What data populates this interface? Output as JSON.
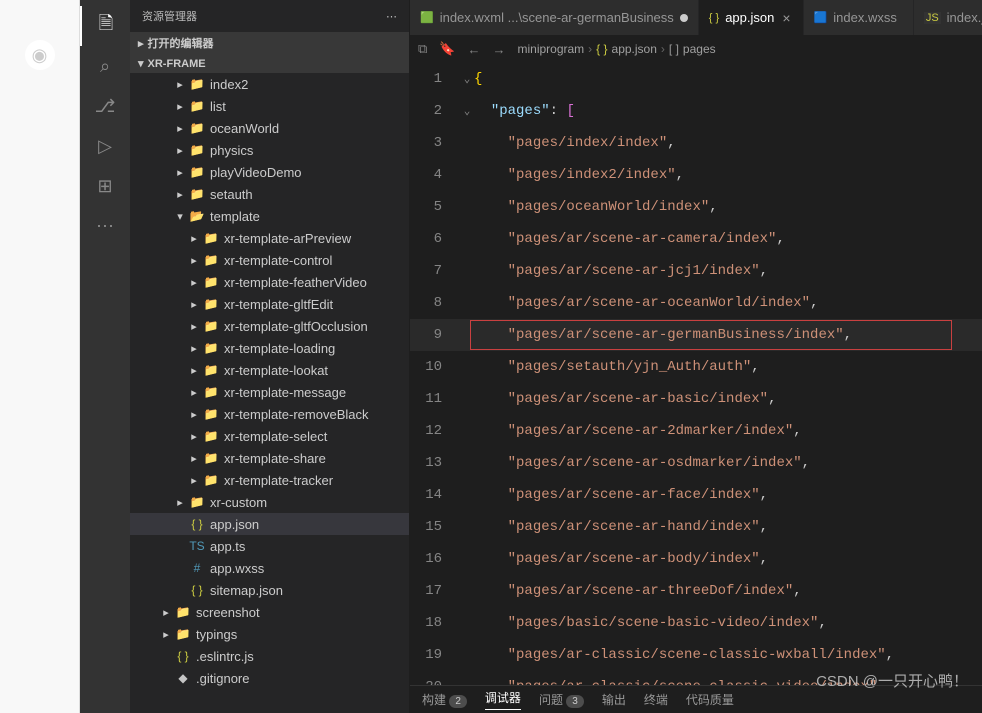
{
  "activity": {
    "icons": [
      "files",
      "search",
      "branch",
      "debug",
      "ext",
      "more"
    ]
  },
  "sidebar": {
    "title": "资源管理器",
    "sections": {
      "openEditors": "打开的编辑器",
      "project": "XR-FRAME"
    },
    "tree": [
      {
        "depth": 3,
        "type": "folder",
        "label": "index2",
        "chev": "▸"
      },
      {
        "depth": 3,
        "type": "folder",
        "label": "list",
        "chev": "▸"
      },
      {
        "depth": 3,
        "type": "folder",
        "label": "oceanWorld",
        "chev": "▸"
      },
      {
        "depth": 3,
        "type": "folder",
        "label": "physics",
        "chev": "▸"
      },
      {
        "depth": 3,
        "type": "folder",
        "label": "playVideoDemo",
        "chev": "▸"
      },
      {
        "depth": 3,
        "type": "folder",
        "label": "setauth",
        "chev": "▸"
      },
      {
        "depth": 3,
        "type": "folder-open",
        "label": "template",
        "chev": "▾"
      },
      {
        "depth": 4,
        "type": "folder",
        "label": "xr-template-arPreview",
        "chev": "▸"
      },
      {
        "depth": 4,
        "type": "folder",
        "label": "xr-template-control",
        "chev": "▸"
      },
      {
        "depth": 4,
        "type": "folder",
        "label": "xr-template-featherVideo",
        "chev": "▸"
      },
      {
        "depth": 4,
        "type": "folder",
        "label": "xr-template-gltfEdit",
        "chev": "▸"
      },
      {
        "depth": 4,
        "type": "folder",
        "label": "xr-template-gltfOcclusion",
        "chev": "▸"
      },
      {
        "depth": 4,
        "type": "folder",
        "label": "xr-template-loading",
        "chev": "▸"
      },
      {
        "depth": 4,
        "type": "folder",
        "label": "xr-template-lookat",
        "chev": "▸"
      },
      {
        "depth": 4,
        "type": "folder",
        "label": "xr-template-message",
        "chev": "▸"
      },
      {
        "depth": 4,
        "type": "folder",
        "label": "xr-template-removeBlack",
        "chev": "▸"
      },
      {
        "depth": 4,
        "type": "folder",
        "label": "xr-template-select",
        "chev": "▸"
      },
      {
        "depth": 4,
        "type": "folder",
        "label": "xr-template-share",
        "chev": "▸"
      },
      {
        "depth": 4,
        "type": "folder",
        "label": "xr-template-tracker",
        "chev": "▸"
      },
      {
        "depth": 3,
        "type": "folder",
        "label": "xr-custom",
        "chev": "▸"
      },
      {
        "depth": 3,
        "type": "json",
        "label": "app.json",
        "selected": true
      },
      {
        "depth": 3,
        "type": "ts",
        "label": "app.ts"
      },
      {
        "depth": 3,
        "type": "wxss",
        "label": "app.wxss"
      },
      {
        "depth": 3,
        "type": "json",
        "label": "sitemap.json"
      },
      {
        "depth": 2,
        "type": "folder",
        "label": "screenshot",
        "chev": "▸"
      },
      {
        "depth": 2,
        "type": "folder",
        "label": "typings",
        "chev": "▸"
      },
      {
        "depth": 2,
        "type": "json",
        "label": ".eslintrc.js",
        "chev": ""
      },
      {
        "depth": 2,
        "type": "git",
        "label": ".gitignore",
        "chev": ""
      }
    ]
  },
  "tabs": [
    {
      "icon": "🟩",
      "label": "index.wxml ...\\scene-ar-germanBusiness",
      "active": false,
      "modified": true
    },
    {
      "icon": "{ }",
      "label": "app.json",
      "active": true,
      "modified": false
    },
    {
      "icon": "🟦",
      "label": "index.wxss",
      "active": false,
      "modified": false
    },
    {
      "icon": "JS",
      "label": "index.js ...\\",
      "active": false,
      "modified": false
    }
  ],
  "breadcrumbs": [
    "miniprogram",
    "app.json",
    "pages"
  ],
  "code": {
    "key": "pages",
    "highlightIndex": 9,
    "lines": [
      {
        "n": 1,
        "content": "{",
        "kind": "open"
      },
      {
        "n": 2,
        "content": "\"pages\": [",
        "kind": "keyopen"
      },
      {
        "n": 3,
        "content": "pages/index/index"
      },
      {
        "n": 4,
        "content": "pages/index2/index"
      },
      {
        "n": 5,
        "content": "pages/oceanWorld/index"
      },
      {
        "n": 6,
        "content": "pages/ar/scene-ar-camera/index"
      },
      {
        "n": 7,
        "content": "pages/ar/scene-ar-jcj1/index"
      },
      {
        "n": 8,
        "content": "pages/ar/scene-ar-oceanWorld/index"
      },
      {
        "n": 9,
        "content": "pages/ar/scene-ar-germanBusiness/index"
      },
      {
        "n": 10,
        "content": "pages/setauth/yjn_Auth/auth"
      },
      {
        "n": 11,
        "content": "pages/ar/scene-ar-basic/index"
      },
      {
        "n": 12,
        "content": "pages/ar/scene-ar-2dmarker/index"
      },
      {
        "n": 13,
        "content": "pages/ar/scene-ar-osdmarker/index"
      },
      {
        "n": 14,
        "content": "pages/ar/scene-ar-face/index"
      },
      {
        "n": 15,
        "content": "pages/ar/scene-ar-hand/index"
      },
      {
        "n": 16,
        "content": "pages/ar/scene-ar-body/index"
      },
      {
        "n": 17,
        "content": "pages/ar/scene-ar-threeDof/index"
      },
      {
        "n": 18,
        "content": "pages/basic/scene-basic-video/index"
      },
      {
        "n": 19,
        "content": "pages/ar-classic/scene-classic-wxball/index"
      },
      {
        "n": 20,
        "content": "pages/ar-classic/scene-classic-video/index"
      }
    ]
  },
  "panel": {
    "build": "构建",
    "buildCount": "2",
    "debugger": "调试器",
    "problems": "问题",
    "problemsCount": "3",
    "output": "输出",
    "terminal": "终端",
    "codeQuality": "代码质量"
  },
  "watermark": "CSDN @一只开心鸭！"
}
